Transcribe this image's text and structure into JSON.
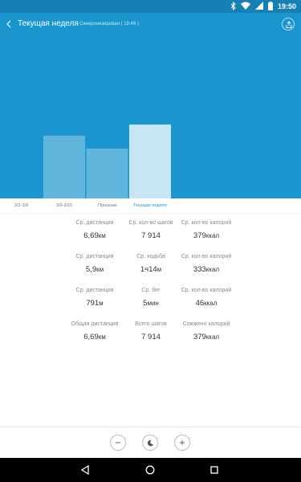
{
  "status_bar": {
    "time": "19:50",
    "icons": [
      "bluetooth-icon",
      "wifi-icon",
      "cellular-icon",
      "battery-icon"
    ]
  },
  "header": {
    "title": "Текущая неделя",
    "sync_text": "Синхронизирован ( 19:46 )",
    "icons": [
      "back-arrow-icon",
      "share-icon"
    ]
  },
  "chart_data": {
    "type": "bar",
    "categories": [
      "3/2-3/8",
      "3/9-3/15",
      "Прошлая",
      "Текущая неделя"
    ],
    "values": [
      68,
      54,
      80
    ],
    "value_note": "relative bar heights (no axis printed)",
    "ylim": [
      0,
      100
    ],
    "active_category": "Текущая неделя",
    "grid": false
  },
  "stats": [
    {
      "label": "Ср. дистанция",
      "value": "6,69",
      "unit": "км"
    },
    {
      "label": "Ср. кол-во шагов",
      "value": "7 914",
      "unit": ""
    },
    {
      "label": "Ср. кол-во калорий",
      "value": "379",
      "unit": "ккал"
    },
    {
      "label": "Ср. дистанция",
      "value": "5,9",
      "unit": "км"
    },
    {
      "label": "Ср. ходьба",
      "value": "1ч14",
      "unit": "м"
    },
    {
      "label": "Ср. кол-во калорий",
      "value": "333",
      "unit": "ккал"
    },
    {
      "label": "Ср. дистанция",
      "value": "791",
      "unit": "м"
    },
    {
      "label": "Ср. бег",
      "value": "5",
      "unit": "мин"
    },
    {
      "label": "Ср. кол-во калорий",
      "value": "46",
      "unit": "ккал"
    },
    {
      "label": "Общая дистанция",
      "value": "6,69",
      "unit": "км"
    },
    {
      "label": "Всего шагов",
      "value": "7 914",
      "unit": ""
    },
    {
      "label": "Сожжено калорий",
      "value": "379",
      "unit": "ккал"
    }
  ],
  "controls": {
    "icons": [
      "minus-icon",
      "moon-icon",
      "plus-icon"
    ]
  },
  "nav": {
    "icons": [
      "back-triangle-icon",
      "home-circle-icon",
      "recents-square-icon"
    ]
  },
  "colors": {
    "hero": "#1a95cd",
    "status_bar": "#167fb4",
    "bar": "#5fb5dc",
    "bar_active": "#c7e5f3",
    "active_tab": "#1a95cd"
  }
}
